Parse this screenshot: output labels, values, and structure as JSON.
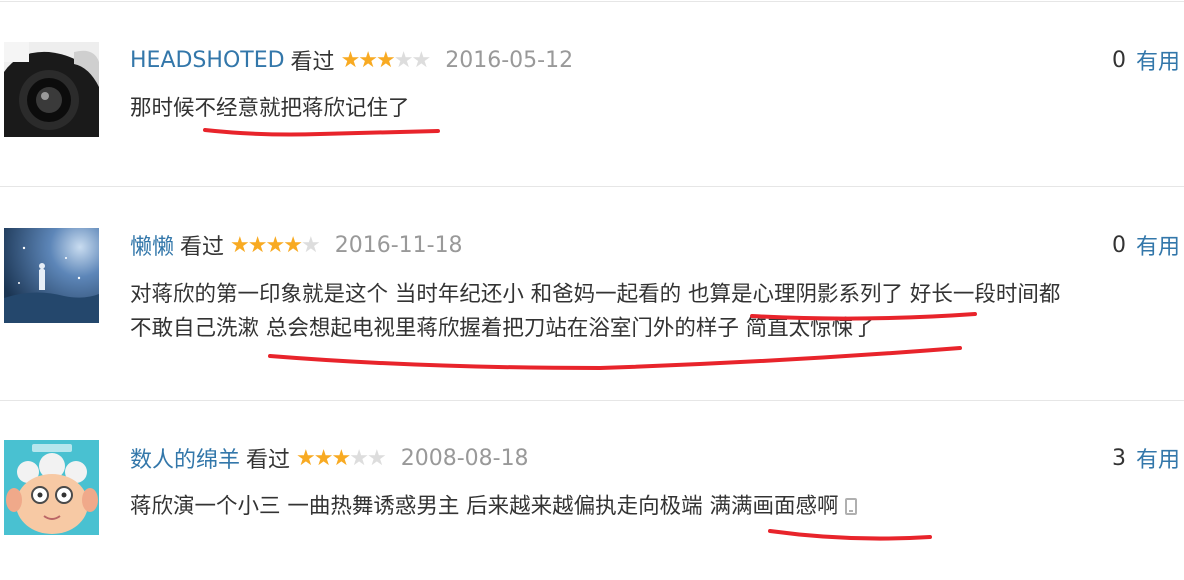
{
  "comments": [
    {
      "username": "HEADSHOTED",
      "status": "看过",
      "rating": 3,
      "max_rating": 5,
      "date": "2016-05-12",
      "votes": "0",
      "useful_label": "有用",
      "text_lines": [
        "那时候不经意就把蒋欣记住了"
      ]
    },
    {
      "username": "懒懒",
      "status": "看过",
      "rating": 4,
      "max_rating": 5,
      "date": "2016-11-18",
      "votes": "0",
      "useful_label": "有用",
      "text_lines": [
        "对蒋欣的第一印象就是这个 当时年纪还小 和爸妈一起看的 也算是心理阴影系列了 好长一段时间都",
        "不敢自己洗漱 总会想起电视里蒋欣握着把刀站在浴室门外的样子 简直太惊悚了"
      ]
    },
    {
      "username": "数人的绵羊",
      "status": "看过",
      "rating": 3,
      "max_rating": 5,
      "date": "2008-08-18",
      "votes": "3",
      "useful_label": "有用",
      "text_lines": [
        "蒋欣演一个小三 一曲热舞诱惑男主 后来越来越偏执走向极端 满满画面感啊"
      ]
    }
  ],
  "colors": {
    "link": "#3377aa",
    "star": "#f8aa22",
    "star_empty": "#dddddd",
    "date": "#999999",
    "annotation": "#e8242b"
  },
  "icons": [
    "phone-icon"
  ]
}
